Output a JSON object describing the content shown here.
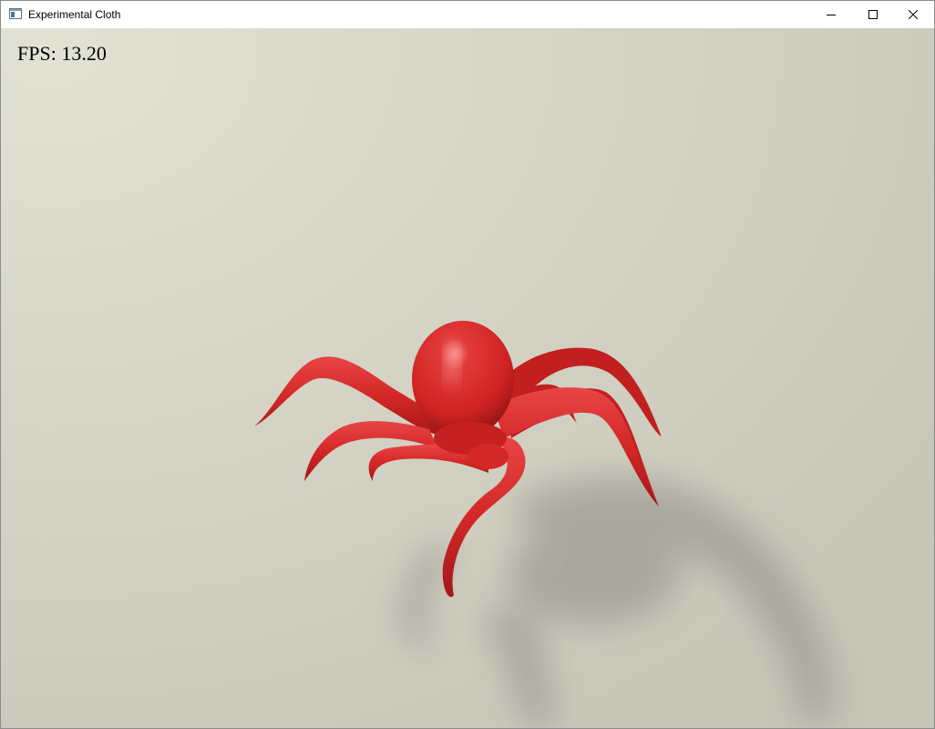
{
  "window": {
    "title": "Experimental Cloth",
    "buttons": {
      "minimize": "minimize-icon",
      "maximize": "maximize-icon",
      "close": "close-icon"
    }
  },
  "viewport": {
    "fps_label": "FPS: 13.20",
    "object": "red-octopus-model",
    "colors": {
      "background_light": "#e1e1d3",
      "background_dark": "#c7c6b8",
      "octopus": "#d82a2a",
      "shadow": "#8f8e85"
    }
  }
}
